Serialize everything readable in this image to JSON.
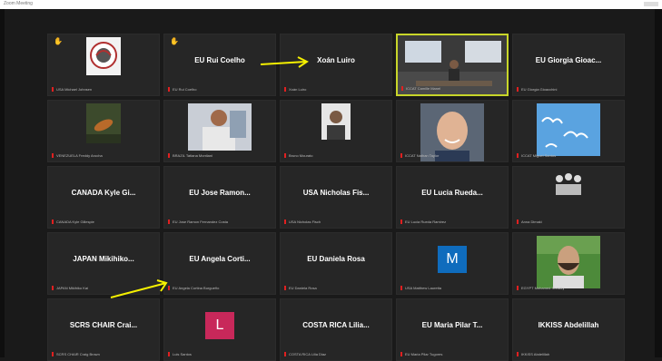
{
  "window": {
    "title": "Zoom Meeting"
  },
  "accent": "#c8d629",
  "arrow_color": "#f5f000",
  "tiles": [
    {
      "name": "",
      "caption": "USA Michael Johnsen",
      "hand": true,
      "avatar": "crest-logo"
    },
    {
      "name": "EU Rui Coelho",
      "caption": "EU Rui Coelho",
      "hand": true
    },
    {
      "name": "Xoán Luiro",
      "caption": "Xoán Luiro"
    },
    {
      "name": "",
      "caption": "ICCAT Camille Manel",
      "video": "conference-room",
      "active": true
    },
    {
      "name": "EU Giorgia Gioac...",
      "caption": "EU Giorgia Gioacchini"
    },
    {
      "name": "",
      "caption": "VENEZUELA Freddy Arocha",
      "avatar": "fish-photo"
    },
    {
      "name": "",
      "caption": "BRAZIL Tatiana Montiani",
      "avatar": "lab-photo"
    },
    {
      "name": "",
      "caption": "Bruno Mourato",
      "avatar": "person-photo"
    },
    {
      "name": "",
      "caption": "ICCAT Nathan Taylor",
      "avatar": "face-photo"
    },
    {
      "name": "",
      "caption": "ICCAT Miguel Santos",
      "avatar": "clouds-photo"
    },
    {
      "name": "CANADA Kyle Gi...",
      "caption": "CANADA Kyle Gillespie"
    },
    {
      "name": "EU Jose Ramon...",
      "caption": "EU Jose Ramon Fernandez Costa"
    },
    {
      "name": "USA Nicholas Fis...",
      "caption": "USA Nicholas Fisch"
    },
    {
      "name": "EU Lucia Rueda...",
      "caption": "EU Lucia Rueda Ramirez"
    },
    {
      "name": "",
      "caption": "Anna Dimaki",
      "avatar": "group-photo"
    },
    {
      "name": "JAPAN Mikihiko...",
      "caption": "JAPAN Mikihiko Kai"
    },
    {
      "name": "EU Angela Corti...",
      "caption": "EU Angela Cortina Burgueño"
    },
    {
      "name": "EU Daniela Rosa",
      "caption": "EU Daniela Rosa"
    },
    {
      "name": "",
      "caption": "USA Matthew Lauretta",
      "letter": "M",
      "letter_bg": "#0f6cbd"
    },
    {
      "name": "",
      "caption": "EGYPT Mohamed Shawky",
      "avatar": "man-green-photo"
    },
    {
      "name": "SCRS CHAIR Crai...",
      "caption": "SCRS CHAIR Craig Brown"
    },
    {
      "name": "",
      "caption": "Luis Santos",
      "letter": "L",
      "letter_bg": "#c8285a"
    },
    {
      "name": "COSTA RICA Lilia...",
      "caption": "COSTA RICA Lilia Diaz"
    },
    {
      "name": "EU Maria Pilar T...",
      "caption": "EU Maria Pilar Tugores"
    },
    {
      "name": "IKKISS Abdelillah",
      "caption": "IKKISS Abdelillah"
    }
  ]
}
